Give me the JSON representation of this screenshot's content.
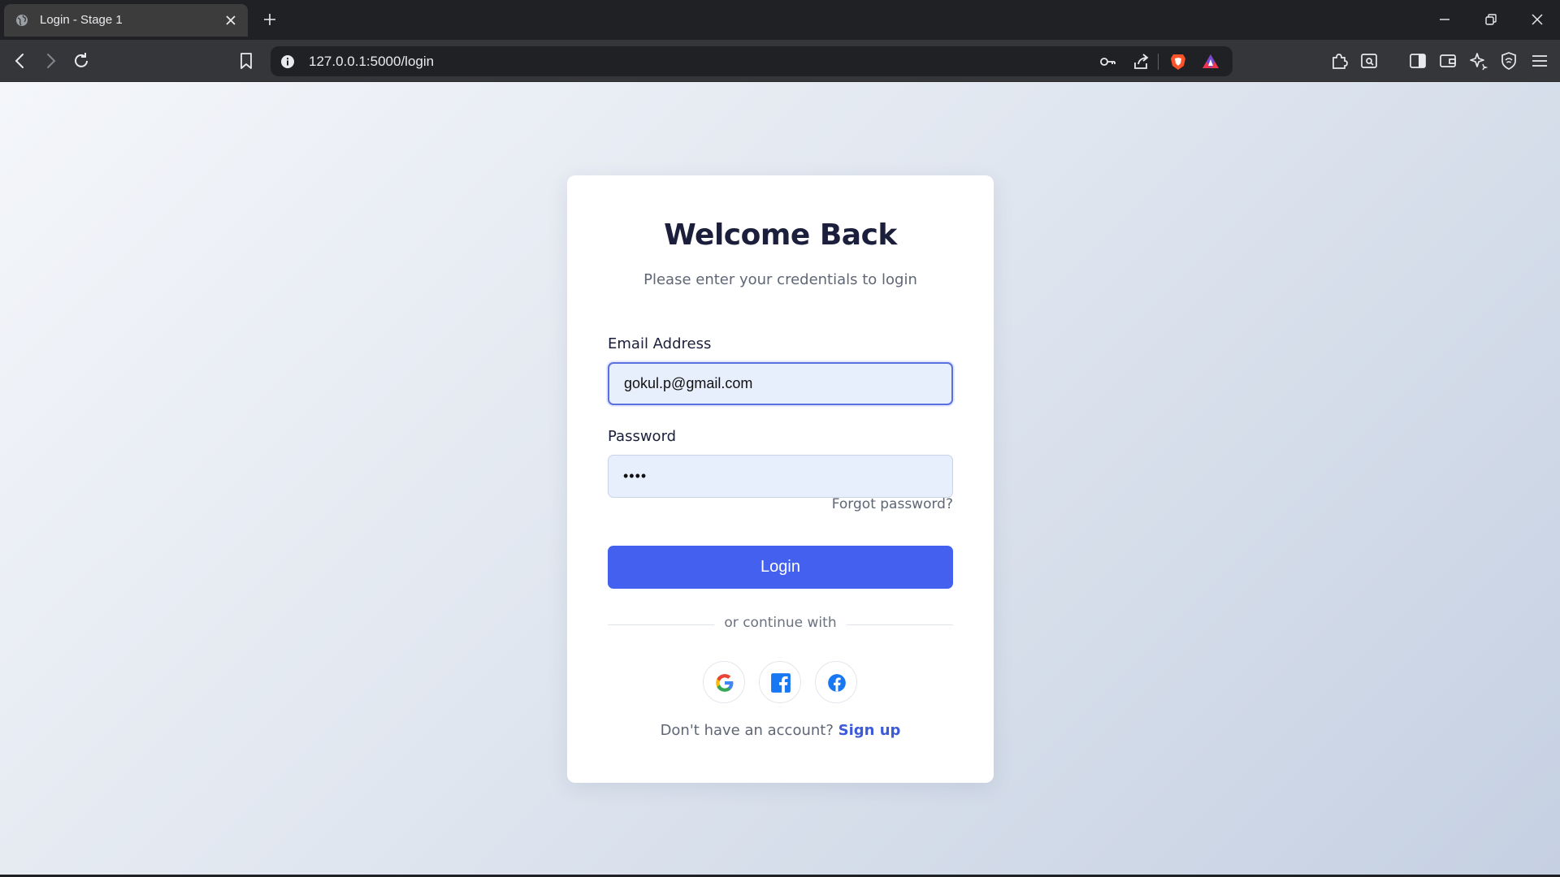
{
  "browser": {
    "tab_title": "Login - Stage 1",
    "url": "127.0.0.1:5000/login",
    "icons": {
      "tab": [
        "globe-icon",
        "close-icon",
        "plus-icon"
      ],
      "window": [
        "minimize-icon",
        "restore-icon",
        "close-window-icon"
      ],
      "toolbar": [
        "back-icon",
        "forward-icon",
        "reload-icon",
        "bookmark-icon",
        "info-icon",
        "key-icon",
        "share-icon",
        "brave-shield-icon",
        "brave-rewards-icon",
        "extensions-icon",
        "screenshot-icon",
        "sidebar-icon",
        "wallet-icon",
        "leo-ai-icon",
        "vpn-icon",
        "menu-icon"
      ]
    }
  },
  "login": {
    "title": "Welcome Back",
    "subtitle": "Please enter your credentials to login",
    "email_label": "Email Address",
    "email_value": "gokul.p@gmail.com",
    "password_label": "Password",
    "password_value": "••••",
    "forgot_label": "Forgot password?",
    "login_button": "Login",
    "divider_text": "or continue with",
    "social_icons": [
      "google-icon",
      "facebook-square-icon",
      "facebook-circle-icon"
    ],
    "signup_prompt": "Don't have an account?",
    "signup_link": "Sign up"
  },
  "colors": {
    "accent": "#4361ee",
    "link": "#3d5bd9",
    "title": "#1b1f3b",
    "input_bg": "#e8effc"
  }
}
